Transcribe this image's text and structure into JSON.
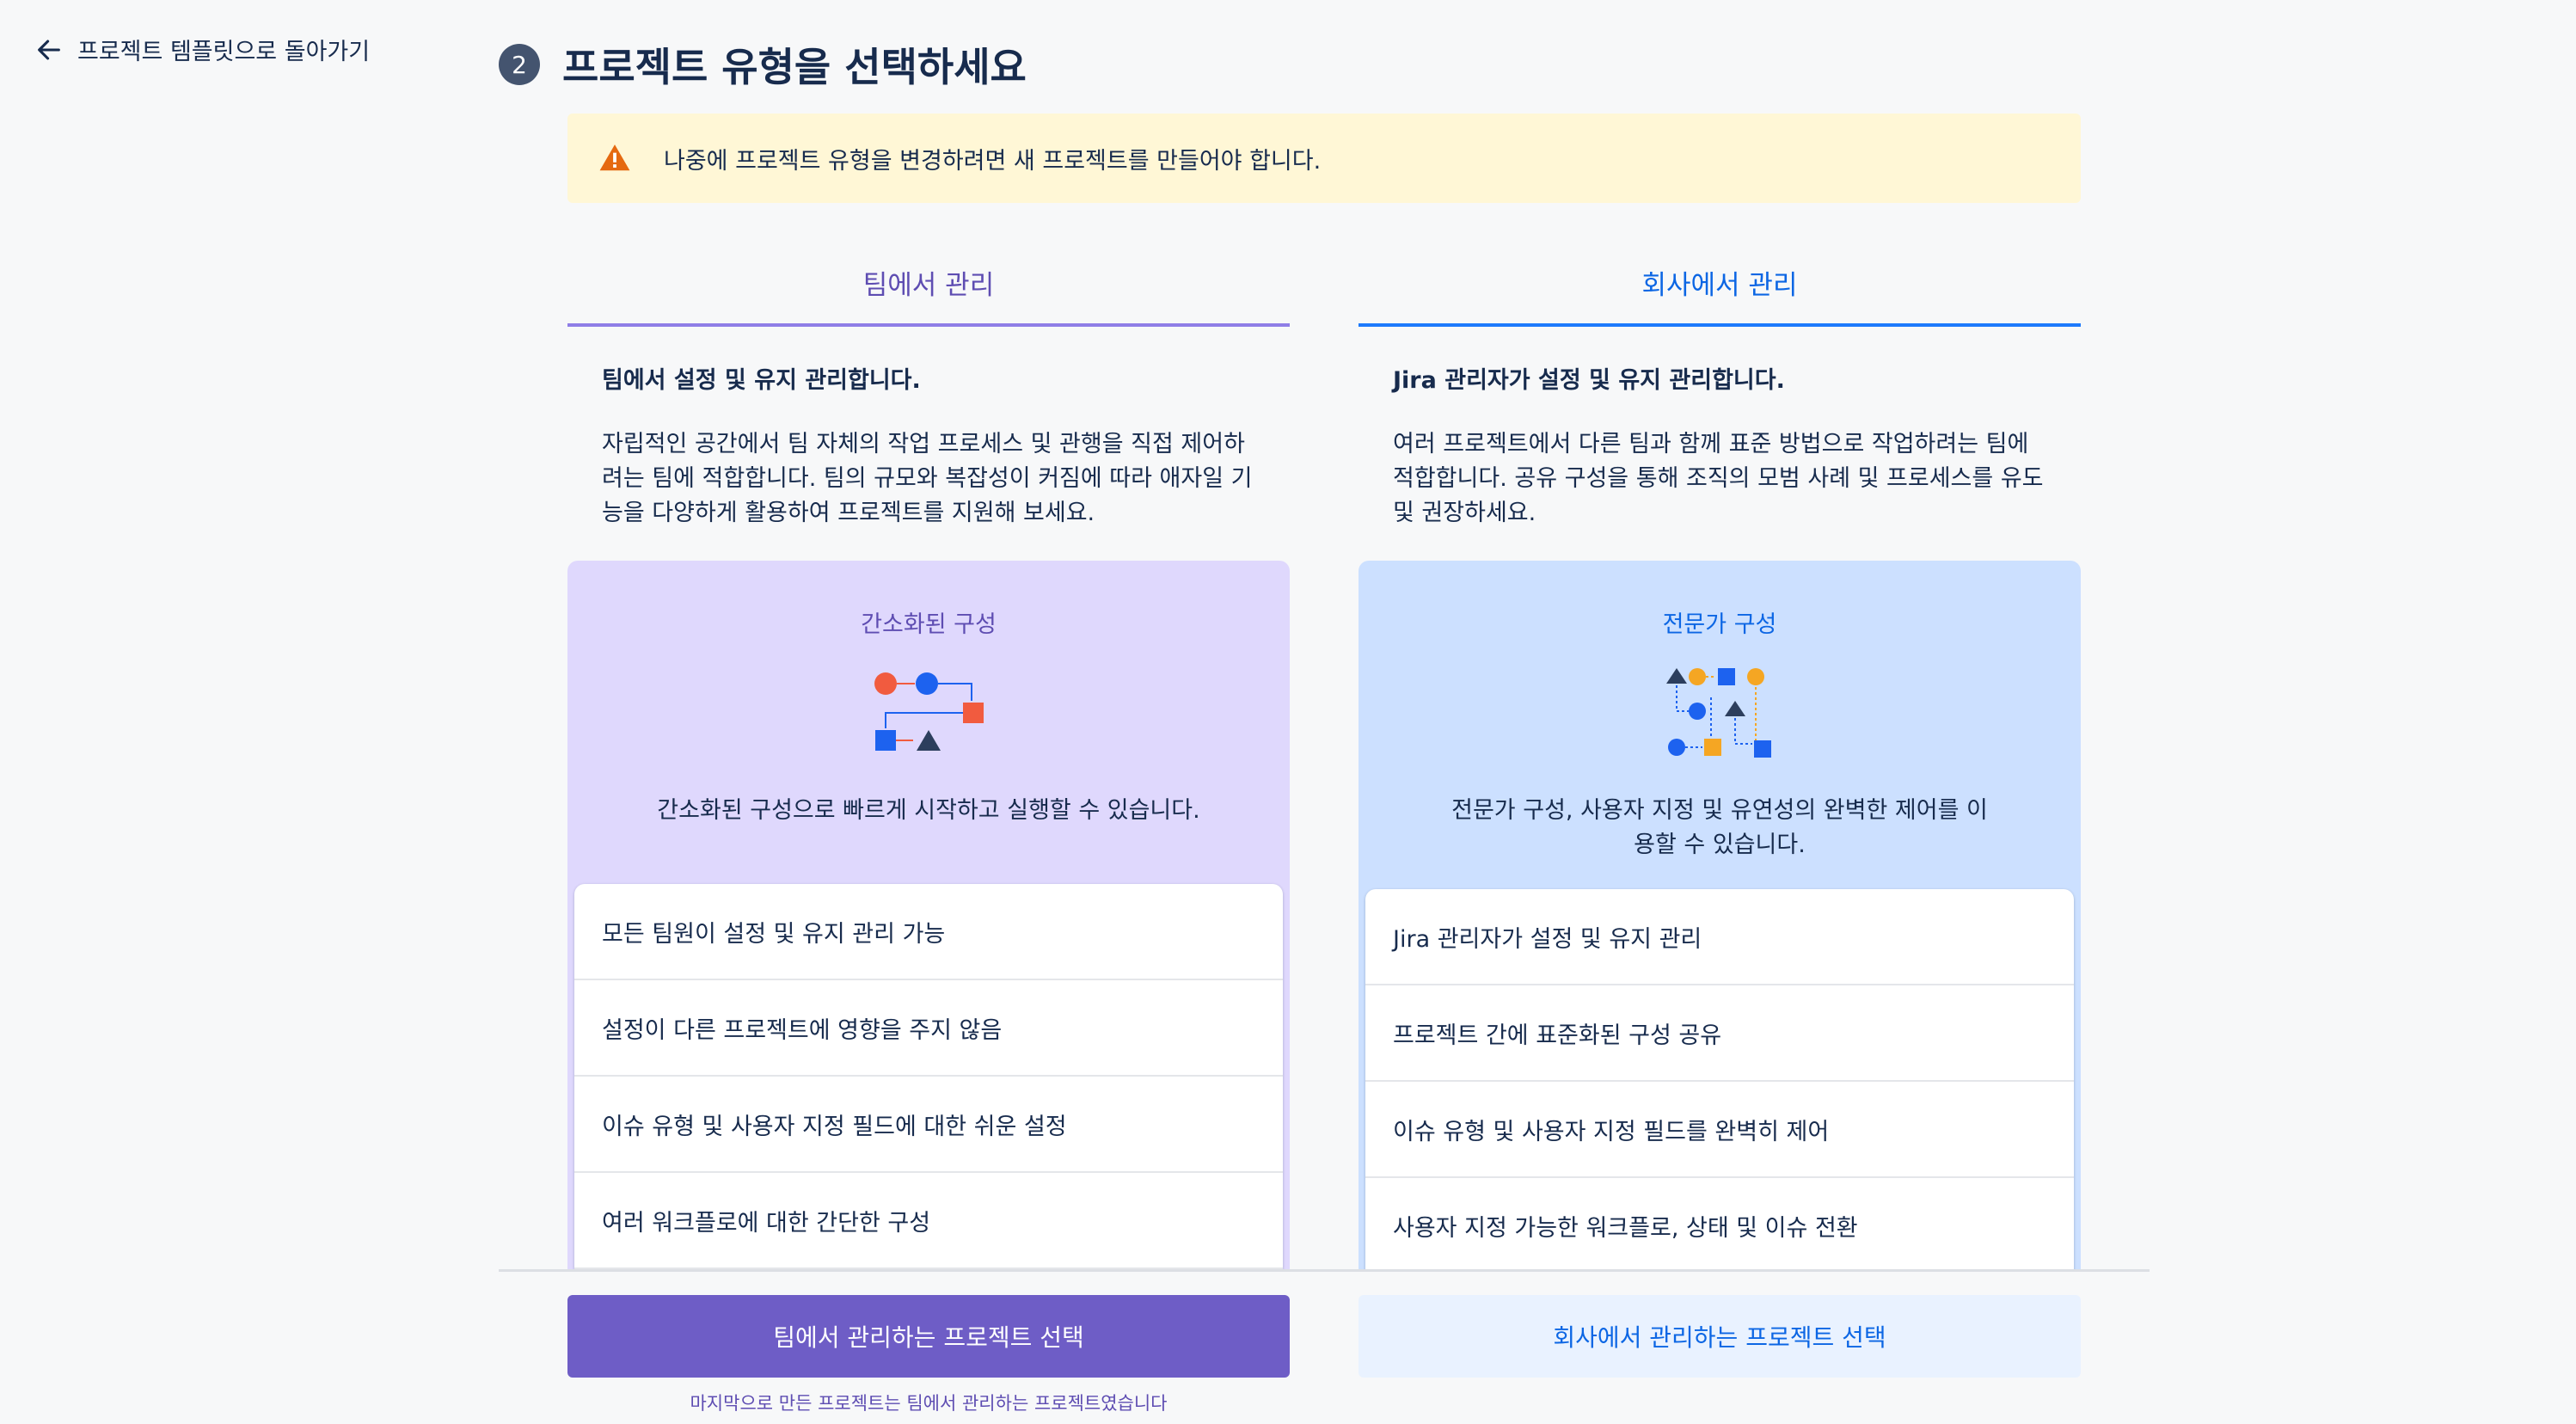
{
  "back_link": {
    "label": "프로젝트 템플릿으로 돌아가기"
  },
  "step": {
    "number": "2",
    "title": "프로젝트 유형을 선택하세요"
  },
  "warning": {
    "text": "나중에 프로젝트 유형을 변경하려면 새 프로젝트를 만들어야 합니다."
  },
  "team": {
    "tab_label": "팀에서 관리",
    "heading": "팀에서 설정 및 유지 관리합니다.",
    "description": "자립적인 공간에서 팀 자체의 작업 프로세스 및 관행을 직접 제어하려는 팀에 적합합니다. 팀의 규모와 복잡성이 커짐에 따라 애자일 기능을 다양하게 활용하여 프로젝트를 지원해 보세요.",
    "config_title": "간소화된 구성",
    "config_desc": "간소화된 구성으로 빠르게 시작하고 실행할 수 있습니다.",
    "features": [
      "모든 팀원이 설정 및 유지 관리 가능",
      "설정이 다른 프로젝트에 영향을 주지 않음",
      "이슈 유형 및 사용자 지정 필드에 대한 쉬운 설정",
      "여러 워크플로에 대한 간단한 구성"
    ],
    "select_button": "팀에서 관리하는 프로젝트 선택",
    "last_note": "마지막으로 만든 프로젝트는 팀에서 관리하는 프로젝트였습니다"
  },
  "company": {
    "tab_label": "회사에서 관리",
    "heading": "Jira 관리자가 설정 및 유지 관리합니다.",
    "description": "여러 프로젝트에서 다른 팀과 함께 표준 방법으로 작업하려는 팀에 적합합니다. 공유 구성을 통해 조직의 모범 사례 및 프로세스를 유도 및 권장하세요.",
    "config_title": "전문가 구성",
    "config_desc": "전문가 구성, 사용자 지정 및 유연성의 완벽한 제어를 이용할 수 있습니다.",
    "features": [
      "Jira 관리자가 설정 및 유지 관리",
      "프로젝트 간에 표준화된 구성 공유",
      "이슈 유형 및 사용자 지정 필드를 완벽히 제어",
      "사용자 지정 가능한 워크플로, 상태 및 이슈 전환"
    ],
    "select_button": "회사에서 관리하는 프로젝트 선택"
  },
  "icons": {
    "back": "arrow-left-icon",
    "warning": "warning-icon"
  },
  "colors": {
    "team_accent": "#6e5dc6",
    "company_accent": "#0c66e4",
    "warning_bg": "#fff7d6",
    "warning_icon": "#e56910"
  }
}
